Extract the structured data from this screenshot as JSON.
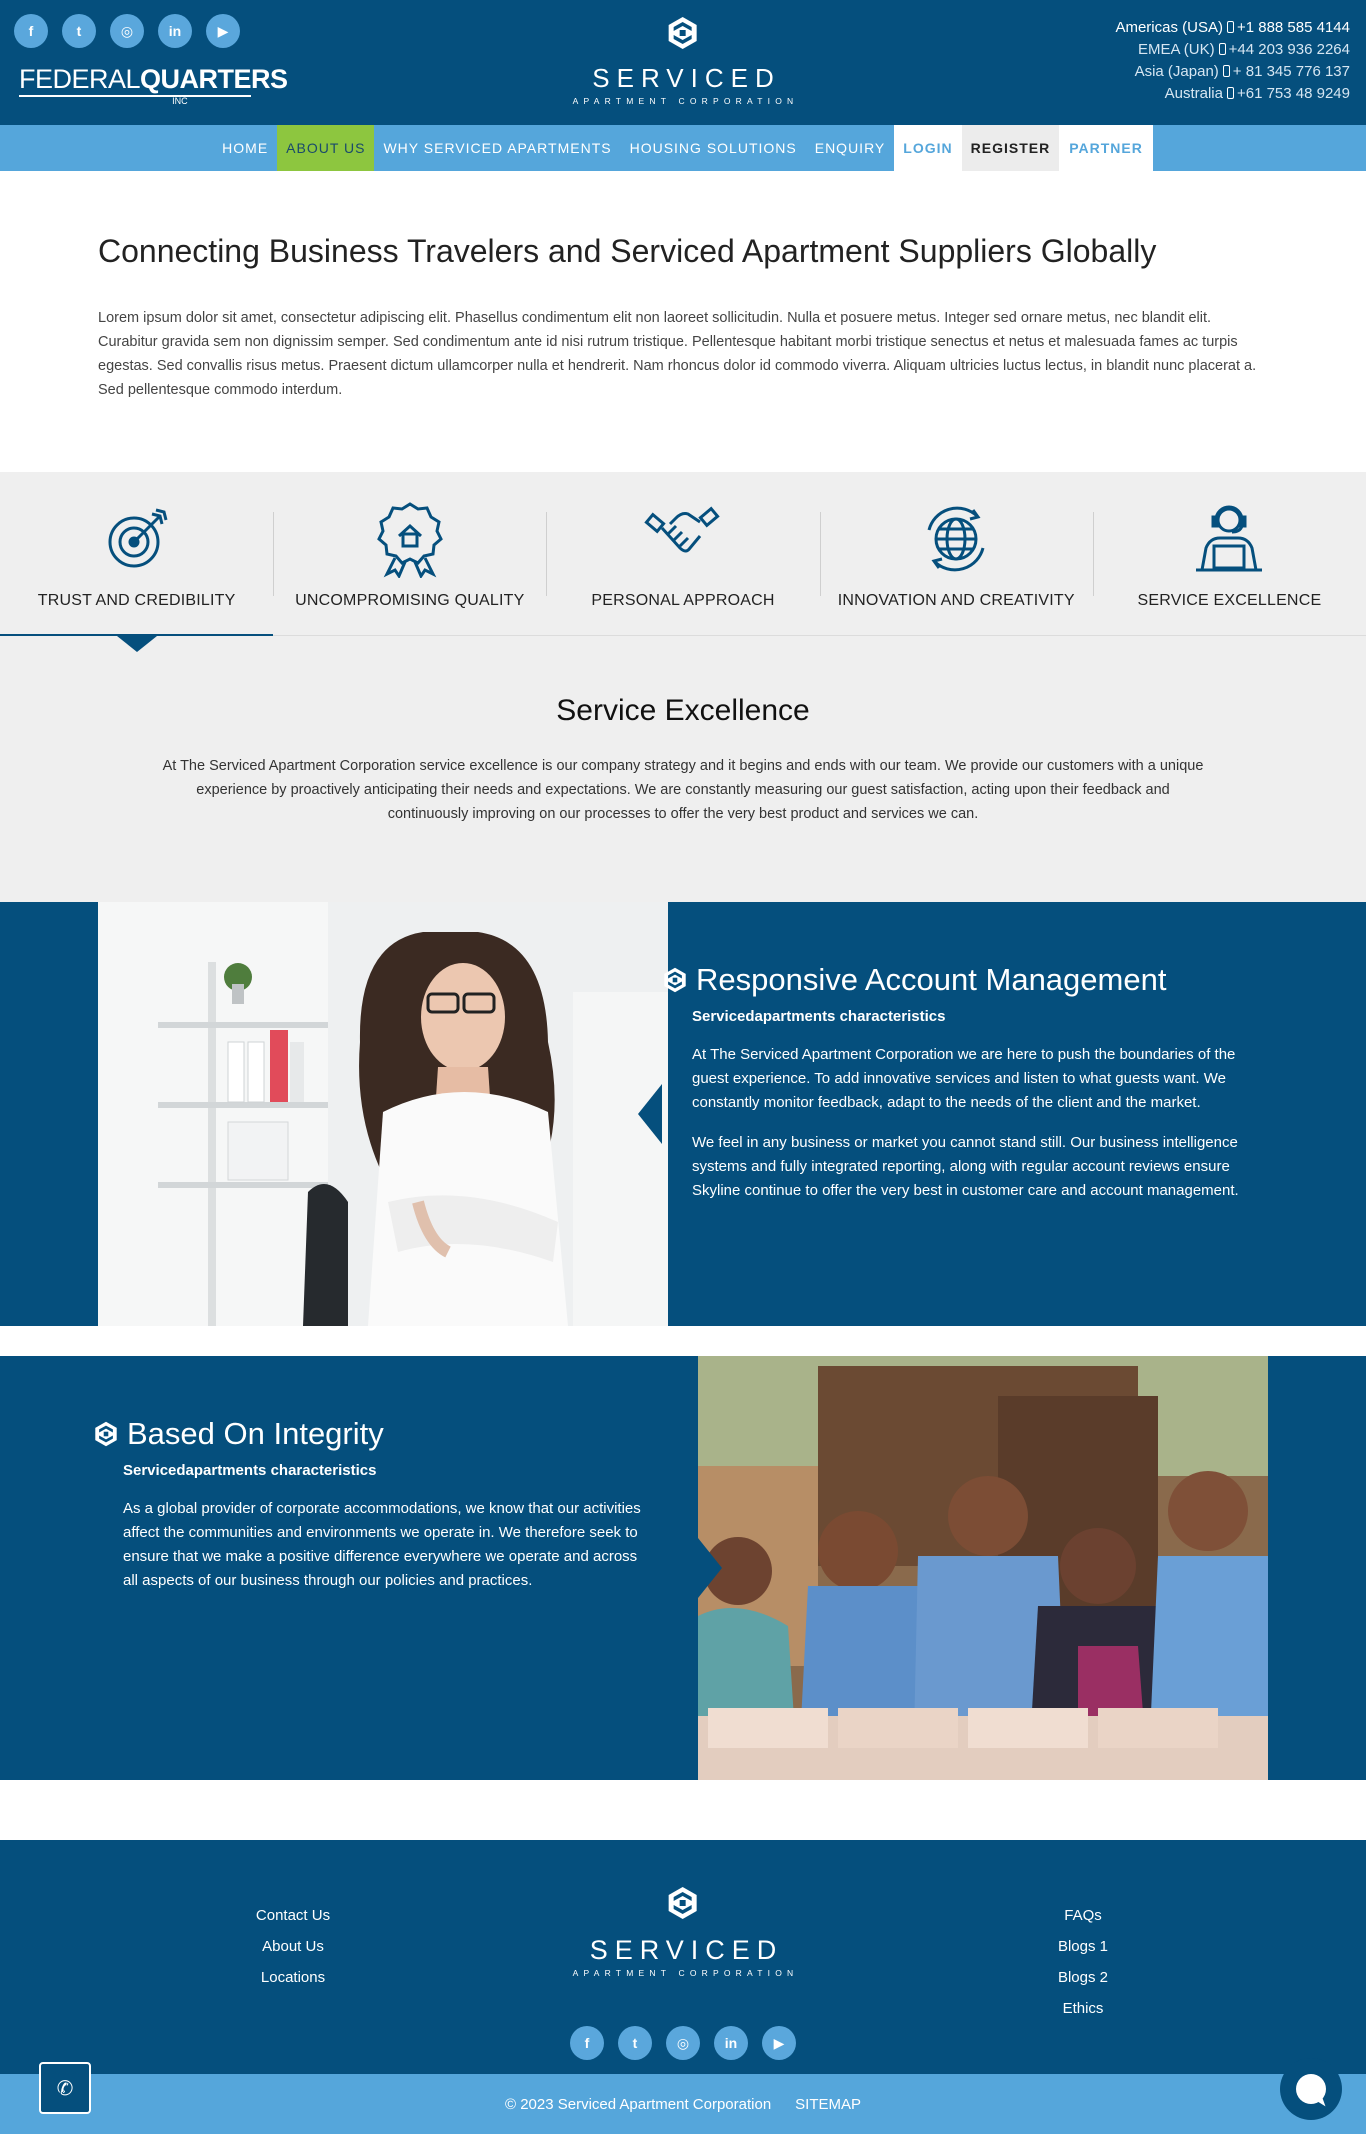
{
  "header": {
    "socials": [
      {
        "icon": "facebook-icon",
        "glyph": "f"
      },
      {
        "icon": "twitter-icon",
        "glyph": "t"
      },
      {
        "icon": "instagram-icon",
        "glyph": "◎"
      },
      {
        "icon": "linkedin-icon",
        "glyph": "in"
      },
      {
        "icon": "youtube-icon",
        "glyph": "▶"
      }
    ],
    "fq_logo": {
      "word1": "FEDERAL",
      "word2": "QUARTERS",
      "inc": "INC"
    },
    "brand": {
      "name": "SERVICED",
      "sub": "APARTMENT CORPORATION"
    },
    "contacts": [
      {
        "region": "Americas (USA)",
        "phone": "+1 888 585 4144"
      },
      {
        "region": "EMEA (UK)",
        "phone": "+44 203 936 2264"
      },
      {
        "region": "Asia (Japan)",
        "phone": "+ 81 345 776 137"
      },
      {
        "region": "Australia",
        "phone": "+61 753 48 9249"
      }
    ]
  },
  "nav": {
    "home": "HOME",
    "about": "ABOUT US",
    "why": "WHY SERVICED APARTMENTS",
    "housing": "HOUSING SOLUTIONS",
    "enquiry": "ENQUIRY",
    "login": "LOGIN",
    "register": "REGISTER",
    "partner": "PARTNER"
  },
  "intro": {
    "title": "Connecting Business Travelers and Serviced Apartment Suppliers Globally",
    "body": "Lorem ipsum dolor sit amet, consectetur adipiscing elit. Phasellus condimentum elit non laoreet sollicitudin. Nulla et posuere metus. Integer sed ornare metus, nec blandit elit. Curabitur gravida sem non dignissim semper. Sed condimentum ante id nisi rutrum tristique. Pellentesque habitant morbi tristique senectus et netus et malesuada fames ac turpis egestas. Sed convallis risus metus. Praesent dictum ullamcorper nulla et hendrerit. Nam rhoncus dolor id commodo viverra. Aliquam ultricies luctus lectus, in blandit nunc placerat a. Sed pellentesque commodo interdum."
  },
  "values": {
    "tabs": [
      {
        "label": "TRUST AND CREDIBILITY",
        "icon": "target-icon"
      },
      {
        "label": "UNCOMPROMISING QUALITY",
        "icon": "quality-badge-icon"
      },
      {
        "label": "PERSONAL APPROACH",
        "icon": "handshake-icon"
      },
      {
        "label": "INNOVATION AND CREATIVITY",
        "icon": "globe-icon"
      },
      {
        "label": "SERVICE EXCELLENCE",
        "icon": "support-agent-icon"
      }
    ],
    "active_tab": 0,
    "panel_title": "Service Excellence",
    "panel_body": "At The Serviced Apartment Corporation service excellence is our company strategy and it begins and ends with our team. We provide our customers with a unique experience by proactively anticipating their needs and expectations. We are constantly measuring our guest satisfaction, acting upon their feedback and continuously improving on our processes to offer the very best product and services we can."
  },
  "features": [
    {
      "title": "Responsive Account Management",
      "subtitle": "Servicedapartments characteristics",
      "paragraphs": [
        "At The Serviced Apartment Corporation we are here to push the boundaries of the guest experience. To add innovative services and listen to what guests want. We constantly monitor feedback, adapt to the needs of the client and the market.",
        "We feel in any business or market you cannot stand still. Our business intelligence systems and fully integrated reporting, along with regular account reviews ensure Skyline continue to offer the very best in customer care and account management."
      ]
    },
    {
      "title": "Based On Integrity",
      "subtitle": "Servicedapartments characteristics",
      "paragraphs": [
        "As a global provider of corporate accommodations, we know that our activities affect the communities and environments we operate in. We therefore seek to ensure that we make a positive difference everywhere we operate and across all aspects of our business through our policies and practices."
      ]
    }
  ],
  "footer": {
    "left_links": [
      "Contact Us",
      "About Us",
      "Locations"
    ],
    "right_links": [
      "FAQs",
      "Blogs 1",
      "Blogs 2",
      "Ethics"
    ],
    "brand": {
      "name": "SERVICED",
      "sub": "APARTMENT CORPORATION"
    },
    "copyright": "© 2023 Serviced Apartment Corporation",
    "sitemap": "SITEMAP"
  },
  "colors": {
    "primary": "#054f7d",
    "nav": "#55a6db",
    "active": "#8dc63f",
    "panel": "#efefef"
  }
}
